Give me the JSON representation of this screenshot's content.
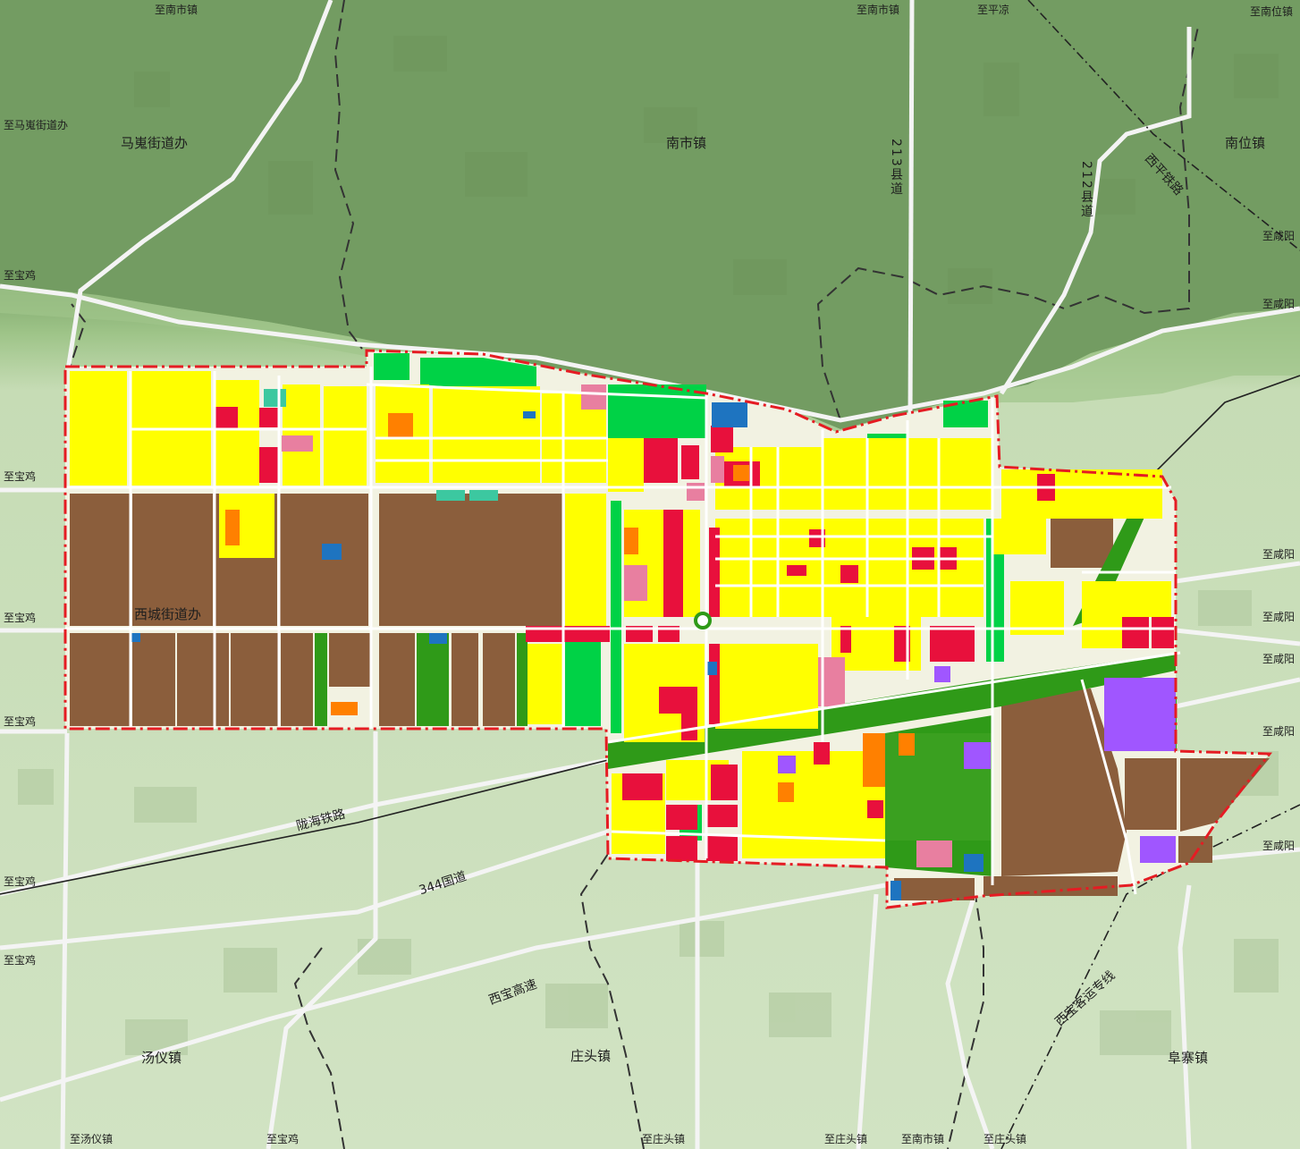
{
  "labels": {
    "directions": {
      "top_nanshi_1": "至南市镇",
      "top_nanshi_2": "至南市镇",
      "top_pingliang": "至平凉",
      "top_nanwei": "至南位镇",
      "majuan": "至马嵬街道办",
      "baoji_1": "至宝鸡",
      "baoji_2": "至宝鸡",
      "baoji_3": "至宝鸡",
      "baoji_4": "至宝鸡",
      "baoji_5": "至宝鸡",
      "baoji_6": "至宝鸡",
      "baoji_bottom": "至宝鸡",
      "xianyang_1": "至咸阳",
      "xianyang_2": "至咸阳",
      "xianyang_3": "至咸阳",
      "xianyang_4": "至咸阳",
      "xianyang_5": "至咸阳",
      "xianyang_6": "至咸阳",
      "xianyang_7": "至咸阳",
      "tangyi": "至汤仪镇",
      "zhuangtou_1": "至庄头镇",
      "zhuangtou_2": "至庄头镇",
      "zhuangtou_3": "至庄头镇",
      "nanshi_bottom": "至南市镇"
    },
    "towns": {
      "majuan": "马嵬街道办",
      "nanshi": "南市镇",
      "nanwei": "南位镇",
      "xicheng": "西城街道办",
      "tangyi": "汤仪镇",
      "zhuangtou": "庄头镇",
      "fuzhai": "阜寨镇"
    },
    "routes": {
      "county_213": "213县道",
      "county_212": "212县道",
      "xiping_rail": "西平铁路",
      "longhai_rail": "陇海铁路",
      "national_344": "344国道",
      "xibao_expressway": "西宝高速",
      "xibao_passenger_rail": "西宝客运专线"
    }
  },
  "colors": {
    "hills_green": "#6f9a5f",
    "plain_green": "#cfe2bf",
    "residential": "#ffff00",
    "industrial": "#8b5e3c",
    "commercial": "#e8103c",
    "green_space": "#00d246",
    "protective_green": "#2f9a18",
    "education": "#ff8000",
    "admin": "#e87fa0",
    "cultural": "#a056ff",
    "utility": "#1e74c0",
    "boundary": "#e51c23"
  }
}
